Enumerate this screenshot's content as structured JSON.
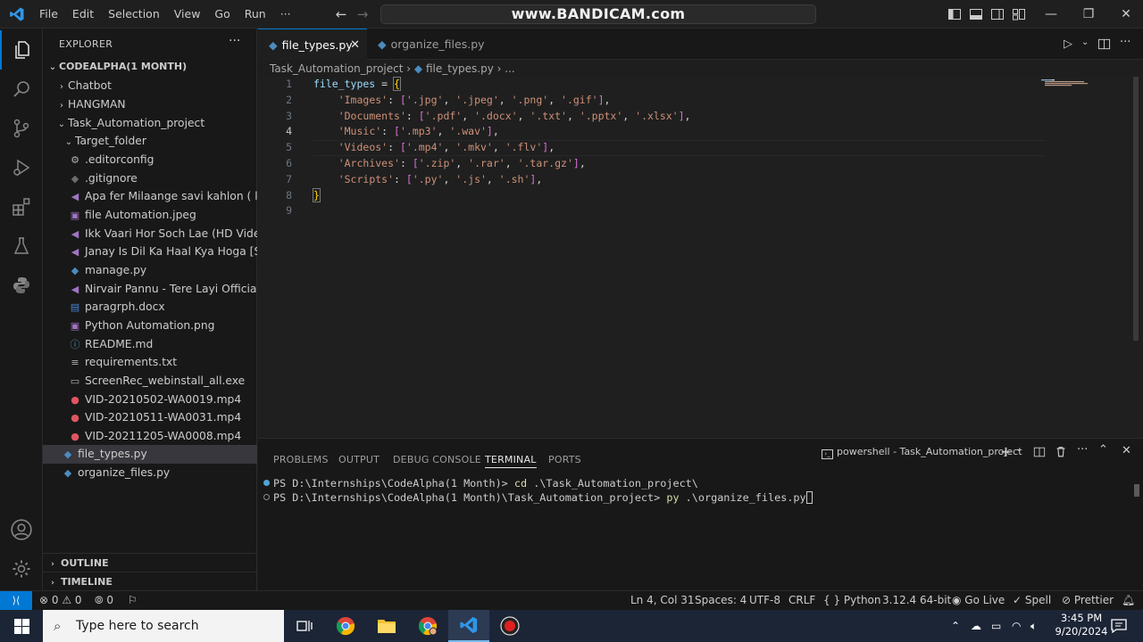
{
  "menu": [
    "File",
    "Edit",
    "Selection",
    "View",
    "Go",
    "Run",
    "···"
  ],
  "command_center": "www.BANDICAM.com",
  "window_controls": {
    "minimize": "—",
    "restore": "❐",
    "close": "✕"
  },
  "explorer": {
    "title": "EXPLORER",
    "more": "···",
    "root": "CODEALPHA(1 MONTH)",
    "items": [
      {
        "label": "Chatbot"
      },
      {
        "label": "HANGMAN"
      },
      {
        "label": "Task_Automation_project"
      },
      {
        "label": "Target_folder"
      },
      {
        "label": ".editorconfig"
      },
      {
        "label": ".gitignore"
      },
      {
        "label": "Apa fer Milaange  savi kahlon ( lyr..."
      },
      {
        "label": "file Automation.jpeg"
      },
      {
        "label": "Ikk Vaari Hor Soch Lae (HD Video)..."
      },
      {
        "label": "Janay Is Dil Ka Haal Kya Hoga [Slo..."
      },
      {
        "label": "manage.py"
      },
      {
        "label": "Nirvair Pannu - Tere Layi  Official ..."
      },
      {
        "label": "paragrph.docx"
      },
      {
        "label": "Python Automation.png"
      },
      {
        "label": "README.md"
      },
      {
        "label": "requirements.txt"
      },
      {
        "label": "ScreenRec_webinstall_all.exe"
      },
      {
        "label": "VID-20210502-WA0019.mp4"
      },
      {
        "label": "VID-20210511-WA0031.mp4"
      },
      {
        "label": "VID-20211205-WA0008.mp4"
      },
      {
        "label": "file_types.py"
      },
      {
        "label": "organize_files.py"
      }
    ],
    "outline": "OUTLINE",
    "timeline": "TIMELINE"
  },
  "tabs": [
    {
      "label": "file_types.py",
      "close": "✕"
    },
    {
      "label": "organize_files.py"
    }
  ],
  "breadcrumb": {
    "folder": "Task_Automation_project",
    "sep": "›",
    "file": "file_types.py",
    "rest": "› ..."
  },
  "code": {
    "line_numbers": [
      "1",
      "2",
      "3",
      "4",
      "5",
      "6",
      "7",
      "8",
      "9"
    ],
    "var": "file_types",
    "eq": " = ",
    "open": "{",
    "close": "}",
    "entries": [
      {
        "key": "'Images'",
        "values": [
          "'.jpg'",
          "'.jpeg'",
          "'.png'",
          "'.gif'"
        ]
      },
      {
        "key": "'Documents'",
        "values": [
          "'.pdf'",
          "'.docx'",
          "'.txt'",
          "'.pptx'",
          "'.xlsx'"
        ]
      },
      {
        "key": "'Music'",
        "values": [
          "'.mp3'",
          "'.wav'"
        ]
      },
      {
        "key": "'Videos'",
        "values": [
          "'.mp4'",
          "'.mkv'",
          "'.flv'"
        ]
      },
      {
        "key": "'Archives'",
        "values": [
          "'.zip'",
          "'.rar'",
          "'.tar.gz'"
        ]
      },
      {
        "key": "'Scripts'",
        "values": [
          "'.py'",
          "'.js'",
          "'.sh'"
        ]
      }
    ]
  },
  "panel": {
    "tabs": [
      "PROBLEMS",
      "OUTPUT",
      "DEBUG CONSOLE",
      "TERMINAL",
      "PORTS"
    ],
    "terminal_name": "powershell - Task_Automation_project",
    "lines": [
      {
        "prompt": "PS D:\\Internships\\CodeAlpha(1 Month)> ",
        "cmd": "cd",
        "args": " .\\Task_Automation_project\\"
      },
      {
        "prompt": "PS D:\\Internships\\CodeAlpha(1 Month)\\Task_Automation_project> ",
        "cmd": "py",
        "args": " .\\organize_files.py"
      }
    ]
  },
  "status": {
    "remote": "⟩⟨",
    "problems": "⊗ 0 ⚠ 0",
    "ports": "⦾ 0",
    "position": "Ln 4, Col 31",
    "spaces": "Spaces: 4",
    "encoding": "UTF-8",
    "eol": "CRLF",
    "language": "{ }  Python",
    "interpreter": "3.12.4 64-bit",
    "golive": "Go Live",
    "spell": "Spell",
    "prettier": "Prettier"
  },
  "taskbar": {
    "search_placeholder": "Type here to search",
    "time": "3:45 PM",
    "date": "9/20/2024"
  },
  "colors": {
    "accent": "#0078d4",
    "string": "#ce9178",
    "variable": "#9cdcfe",
    "bracket": "#ffd700"
  }
}
